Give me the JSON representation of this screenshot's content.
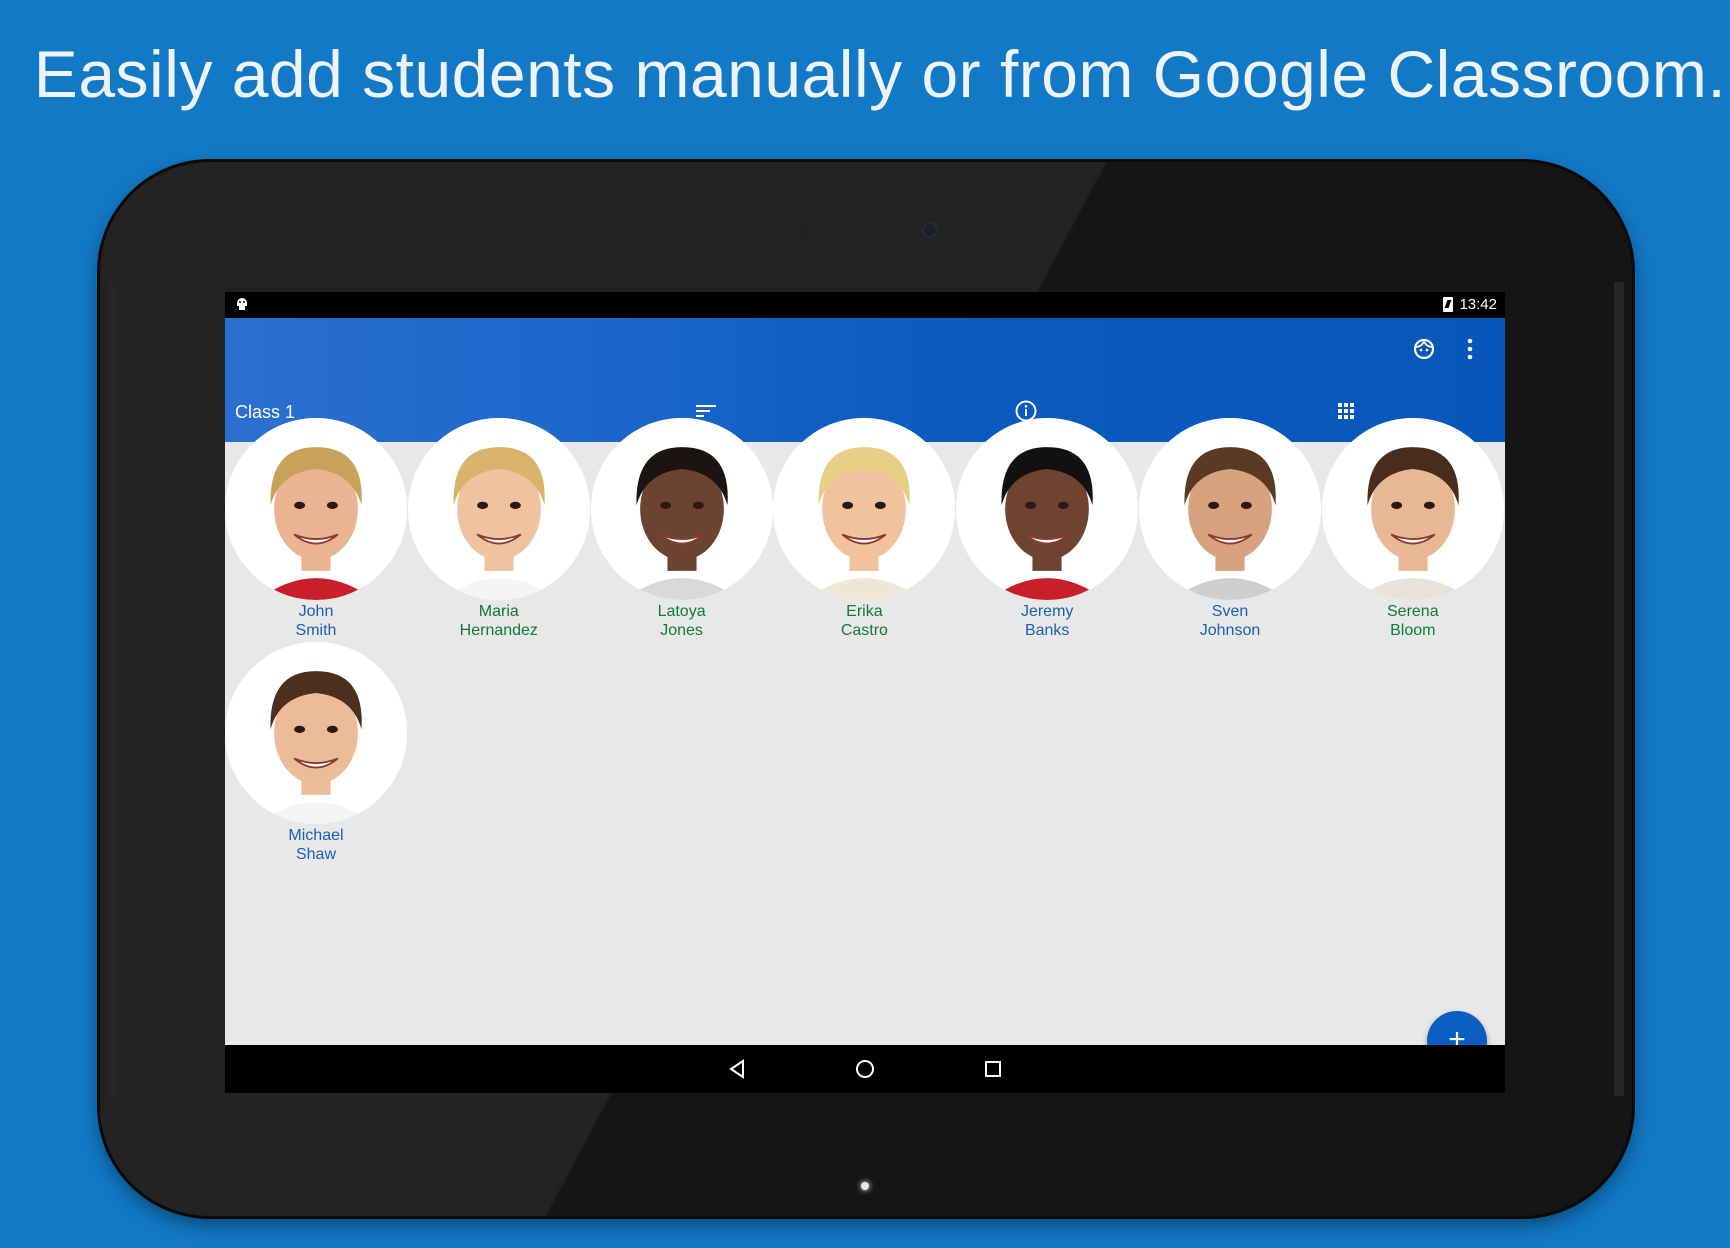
{
  "headline": "Easily add students manually or from Google Classroom.",
  "status": {
    "time": "13:42"
  },
  "appbar": {
    "class_title": "Class 1"
  },
  "icons": {
    "notification": "android-icon",
    "battery": "battery-charging-icon",
    "face": "face-icon",
    "overflow": "more-vert-icon",
    "sort": "sort-icon",
    "info": "info-icon",
    "grid": "grid-view-icon",
    "add": "add-icon",
    "back": "back-icon",
    "home": "home-icon",
    "recents": "recents-icon"
  },
  "fab_label": "+",
  "students": [
    {
      "first": "John",
      "last": "Smith",
      "color": "#1a5fb4"
    },
    {
      "first": "Maria",
      "last": "Hernandez",
      "color": "#0f7a3b"
    },
    {
      "first": "Latoya",
      "last": "Jones",
      "color": "#0f7a3b"
    },
    {
      "first": "Erika",
      "last": "Castro",
      "color": "#0f7a3b"
    },
    {
      "first": "Jeremy",
      "last": "Banks",
      "color": "#1a5fb4"
    },
    {
      "first": "Sven",
      "last": "Johnson",
      "color": "#1a5fb4"
    },
    {
      "first": "Serena",
      "last": "Bloom",
      "color": "#0f7a3b"
    },
    {
      "first": "Michael",
      "last": "Shaw",
      "color": "#1a5fb4"
    }
  ],
  "colors": {
    "background": "#1279c6",
    "appbar": "#0b5bc0",
    "fab": "#0b5ec2",
    "screen": "#e8e8e8"
  }
}
